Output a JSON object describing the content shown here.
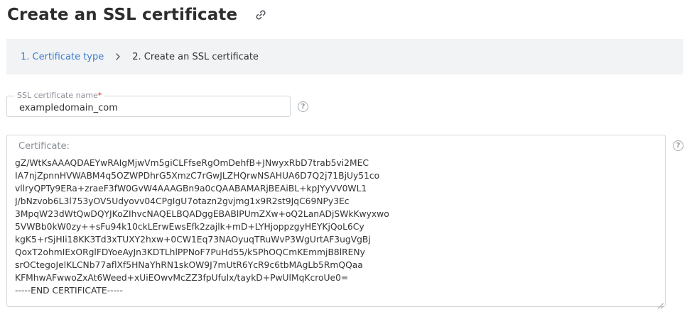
{
  "page": {
    "title": "Create an SSL certificate",
    "link_icon": "link-icon"
  },
  "breadcrumb": {
    "step1": "1. Certificate type",
    "separator_icon": "chevron-right-icon",
    "step2": "2. Create an SSL certificate"
  },
  "form": {
    "name_field": {
      "label": "SSL certificate name",
      "required_mark": "*",
      "value": "exampledomain_com"
    },
    "certificate": {
      "label": "Certificate:",
      "value": "gZ/WtKsAAAQDAEYwRAIgMjwVm5giCLFfseRgOmDehfB+JNwyxRbD7trab5vi2MEC\nIA7njZpnnHVWABM4q5OZWPDhrG5XmzC7rGwJLZHQrwNSAHUA6D7Q2j71BjUy51co\nvllryQPTy9ERa+zraeF3fW0GvW4AAAGBn9a0cQAABAMARjBEAiBL+kpJYyVV0WL1\nJ/bNzvob6L3l753yOV5Udyovv04CPgIgU7otazn2gvjmg1x9R2st9JqC69NPy3Ec\n3MpqW23dWtQwDQYJKoZIhvcNAQELBQADggEBABlPUmZXw+oQ2LanADjSWkKwyxwo\n5VWBb0kW0zy++sFu94k10ckLErwEwsEfk2zajlk+mD+LYHjoppzgyHEYKjQoL6Cy\nkgK5+rSjHIi18KK3Td3xTUXY2hxw+0CW1Eq73NAOyuqTRuWvP3WgUrtAF3ugVgBj\nQoxT2ohmIExORglFDYoeAyJn3KDTLhlPPNoF7PuHd55/kSPhOQCmKEmmjB8lRENy\nsrOCtegoJelKLCNb77aflXf5HNaYhRN1skOW9J7mUtR6YcR9c6tbMAgLb5RmQQaa\nKFMhwAFwwoZxAt6Weed+xUiEOwvMcZZ3fpUfulx/taykD+PwUlMqKcroUe0=\n-----END CERTIFICATE-----"
    },
    "help_icon": "question-circle-icon"
  }
}
